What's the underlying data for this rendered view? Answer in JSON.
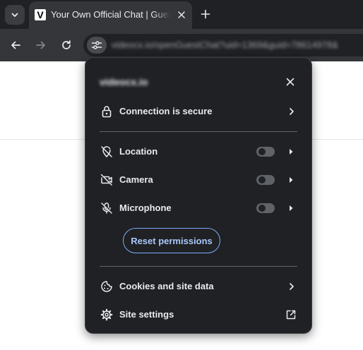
{
  "browser": {
    "tab": {
      "favicon_letter": "V",
      "title": "Your Own Official Chat | Guest Chat"
    },
    "url": "videocx.io/openGuestChat?uid=1369&guid=78614978&"
  },
  "popup": {
    "origin": "videocx.io",
    "connection_label": "Connection is secure",
    "permissions": [
      {
        "label": "Location",
        "enabled": false
      },
      {
        "label": "Camera",
        "enabled": false
      },
      {
        "label": "Microphone",
        "enabled": false
      }
    ],
    "reset_label": "Reset permissions",
    "cookies_label": "Cookies and site data",
    "site_settings_label": "Site settings"
  },
  "colors": {
    "tabstrip": "#202124",
    "toolbar": "#35363a",
    "popup_bg": "#202124",
    "accent": "#a8c7fa",
    "icon": "#e8eaed"
  },
  "icons": {
    "tab_search": "chevron-down-icon",
    "tab_close": "close-icon",
    "new_tab": "plus-icon",
    "back": "arrow-left-icon",
    "forward": "arrow-right-icon",
    "reload": "reload-icon",
    "site_info": "tune-icon",
    "connection": "lock-icon",
    "location": "location-off-icon",
    "camera": "camera-off-icon",
    "microphone": "mic-off-icon",
    "cookies": "cookie-icon",
    "site_settings": "gear-icon",
    "open_external": "open-in-new-icon"
  }
}
